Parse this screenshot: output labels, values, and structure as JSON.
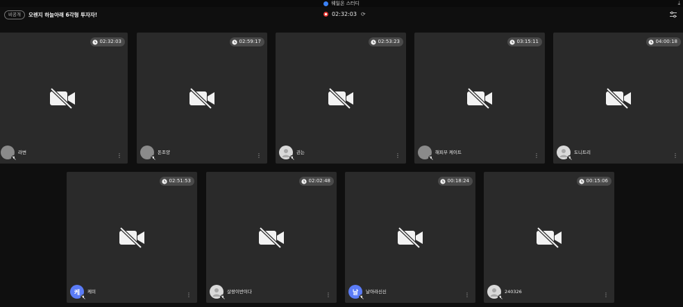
{
  "window": {
    "title": "웨일온 스터디"
  },
  "header": {
    "visibility_badge": "비공개",
    "room_title": "오렌지 하늘아래 6각형 투자자!",
    "timer": "02:32:03"
  },
  "colors": {
    "tile_bg": "#2a2a2a",
    "page_bg": "#0f0f0f",
    "rec": "#e53935",
    "avatar_blue": "#5b7cf7"
  },
  "participants": [
    {
      "name": "라변",
      "time": "02:32:03",
      "avatar_text": "",
      "avatar_style": "image"
    },
    {
      "name": "돈조양",
      "time": "02:59:17",
      "avatar_text": "",
      "avatar_style": "image"
    },
    {
      "name": "괸는",
      "time": "02:53:23",
      "avatar_text": "",
      "avatar_style": "default"
    },
    {
      "name": "해피부 케이트",
      "time": "03:15:11",
      "avatar_text": "",
      "avatar_style": "image"
    },
    {
      "name": "도니트리",
      "time": "04:00:18",
      "avatar_text": "",
      "avatar_style": "default"
    },
    {
      "name": "케미",
      "time": "02:51:53",
      "avatar_text": "케",
      "avatar_style": "blue"
    },
    {
      "name": "살랑이반이다",
      "time": "02:02:48",
      "avatar_text": "",
      "avatar_style": "default"
    },
    {
      "name": "날아라신신",
      "time": "00:18:24",
      "avatar_text": "날",
      "avatar_style": "blue"
    },
    {
      "name": "240326",
      "time": "00:15:06",
      "avatar_text": "",
      "avatar_style": "default"
    }
  ]
}
